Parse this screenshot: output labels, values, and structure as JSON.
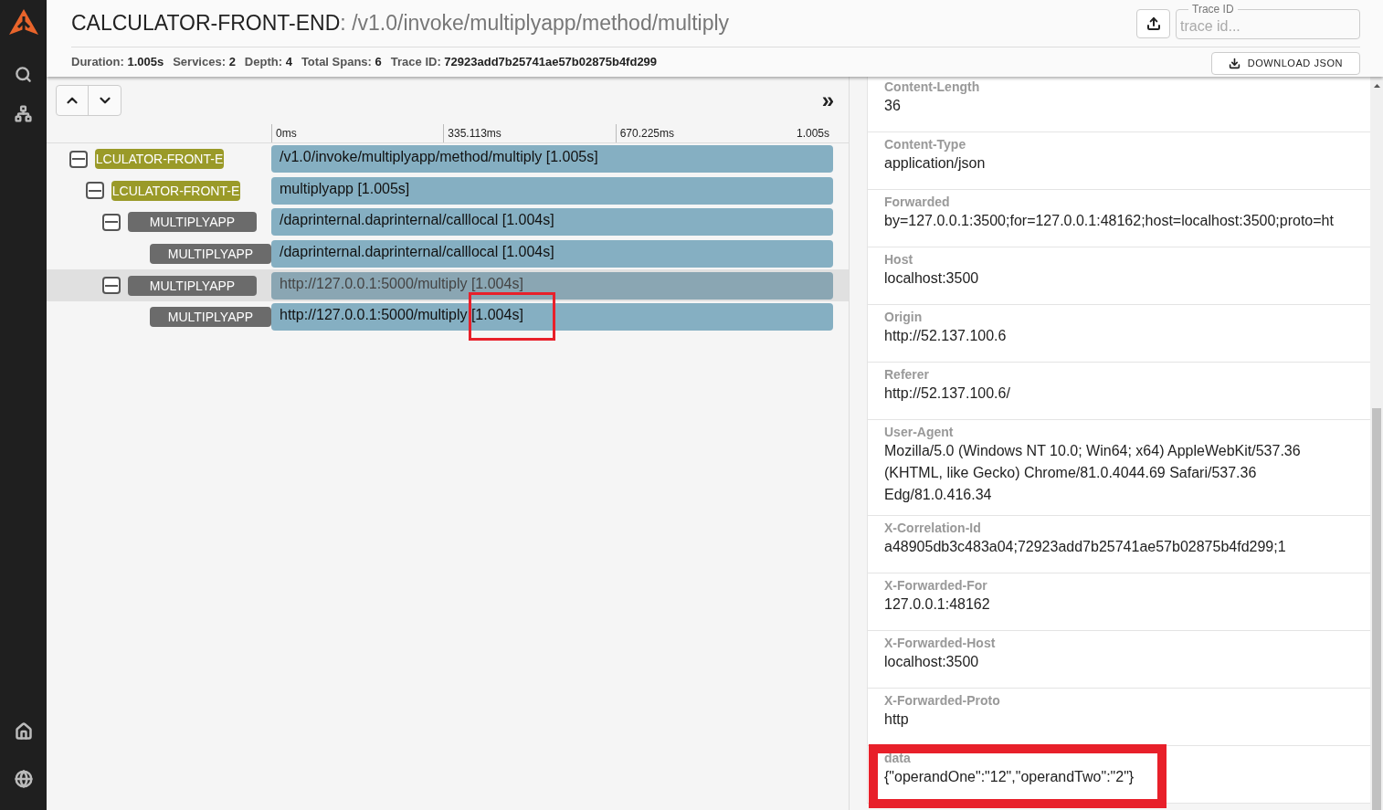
{
  "header": {
    "service": "CALCULATOR-FRONT-END",
    "separator": ": ",
    "operation": "/v1.0/invoke/multiplyapp/method/multiply",
    "stats": [
      {
        "label": "Duration:",
        "value": "1.005s"
      },
      {
        "label": "Services:",
        "value": "2"
      },
      {
        "label": "Depth:",
        "value": "4"
      },
      {
        "label": "Total Spans:",
        "value": "6"
      },
      {
        "label": "Trace ID:",
        "value": "72923add7b25741ae57b02875b4fd299"
      }
    ],
    "trace_field": {
      "label": "Trace ID",
      "placeholder": "trace id..."
    },
    "download_button": "DOWNLOAD JSON"
  },
  "timeline": {
    "expand_icon": "»",
    "ticks": [
      "0ms",
      "335.113ms",
      "670.225ms",
      "1.005s"
    ],
    "spans": [
      {
        "service": "LCULATOR-FRONT-E",
        "color": "#9a9a28",
        "operation": "/v1.0/invoke/multiplyapp/method/multiply [1.005s]",
        "expanded": true,
        "selected": false,
        "highlighted": false,
        "children": [
          {
            "service": "LCULATOR-FRONT-E",
            "color": "#9a9a28",
            "operation": "multiplyapp [1.005s]",
            "expanded": true,
            "selected": false,
            "highlighted": false,
            "children": [
              {
                "service": "MULTIPLYAPP",
                "color": "#6b6b6b",
                "operation": "/daprinternal.daprinternal/calllocal [1.004s]",
                "expanded": true,
                "selected": false,
                "highlighted": false,
                "children": [
                  {
                    "service": "MULTIPLYAPP",
                    "color": "#6b6b6b",
                    "operation": "/daprinternal.daprinternal/calllocal [1.004s]",
                    "selected": false,
                    "highlighted": false
                  }
                ]
              },
              {
                "service": "MULTIPLYAPP",
                "color": "#6b6b6b",
                "operation": "http://127.0.0.1:5000/multiply [1.004s]",
                "expanded": true,
                "selected": true,
                "highlighted": false,
                "children": [
                  {
                    "service": "MULTIPLYAPP",
                    "color": "#6b6b6b",
                    "operation": "http://127.0.0.1:5000/multiply [1.004s]",
                    "selected": false,
                    "highlighted": true
                  }
                ]
              }
            ]
          }
        ]
      }
    ]
  },
  "details": [
    {
      "key": "Content-Length",
      "value": "36",
      "highlighted": false
    },
    {
      "key": "Content-Type",
      "value": "application/json",
      "highlighted": false
    },
    {
      "key": "Forwarded",
      "value": "by=127.0.0.1:3500;for=127.0.0.1:48162;host=localhost:3500;proto=ht",
      "highlighted": false
    },
    {
      "key": "Host",
      "value": "localhost:3500",
      "highlighted": false
    },
    {
      "key": "Origin",
      "value": "http://52.137.100.6",
      "highlighted": false
    },
    {
      "key": "Referer",
      "value": "http://52.137.100.6/",
      "highlighted": false
    },
    {
      "key": "User-Agent",
      "value": "Mozilla/5.0 (Windows NT 10.0; Win64; x64) AppleWebKit/537.36 (KHTML, like Gecko) Chrome/81.0.4044.69 Safari/537.36 Edg/81.0.416.34",
      "highlighted": false
    },
    {
      "key": "X-Correlation-Id",
      "value": "a48905db3c483a04;72923add7b25741ae57b02875b4fd299;1",
      "highlighted": false
    },
    {
      "key": "X-Forwarded-For",
      "value": "127.0.0.1:48162",
      "highlighted": false
    },
    {
      "key": "X-Forwarded-Host",
      "value": "localhost:3500",
      "highlighted": false
    },
    {
      "key": "X-Forwarded-Proto",
      "value": "http",
      "highlighted": false
    },
    {
      "key": "data",
      "value": "{\"operandOne\":\"12\",\"operandTwo\":\"2\"}",
      "highlighted": true
    }
  ]
}
